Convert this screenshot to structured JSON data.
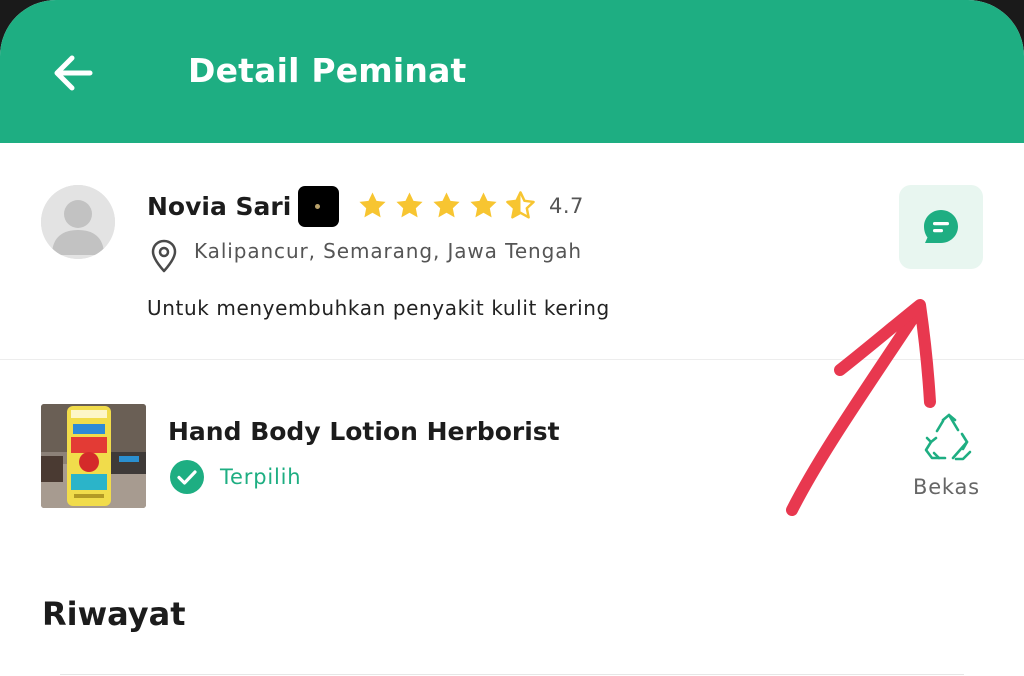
{
  "header": {
    "title": "Detail Peminat",
    "back_icon": "arrow-left-icon",
    "background_color": "#1eae82"
  },
  "user": {
    "name": "Novia Sari",
    "rating": "4.7",
    "rating_stars": 4.5,
    "location": "Kalipancur, Semarang, Jawa Tengah",
    "reason": "Untuk menyembuhkan penyakit kulit kering",
    "avatar_icon": "default-avatar",
    "badge_icon": "badge-icon",
    "chat_icon": "chat-icon"
  },
  "product": {
    "name": "Hand Body Lotion Herborist",
    "status": "Terpilih",
    "status_icon": "check-circle-icon",
    "condition": "Bekas",
    "condition_icon": "recycle-icon"
  },
  "history": {
    "title": "Riwayat"
  },
  "colors": {
    "accent": "#1eae82",
    "star": "#f7c531",
    "annotation": "#e8384f"
  }
}
